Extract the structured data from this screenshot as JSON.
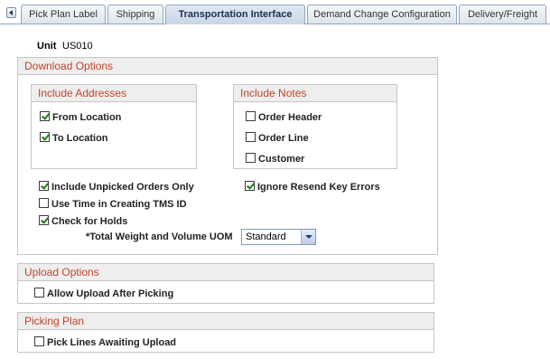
{
  "tabs": [
    {
      "label": "Pick Plan Label",
      "active": false
    },
    {
      "label": "Shipping",
      "active": false
    },
    {
      "label": "Transportation Interface",
      "active": true
    },
    {
      "label": "Demand Change Configuration",
      "active": false
    },
    {
      "label": "Delivery/Freight",
      "active": false
    }
  ],
  "unit": {
    "label": "Unit",
    "value": "US010"
  },
  "download_options": {
    "title": "Download Options",
    "include_addresses": {
      "title": "Include Addresses",
      "from_location": {
        "label": "From Location",
        "checked": true
      },
      "to_location": {
        "label": "To Location",
        "checked": true
      }
    },
    "include_notes": {
      "title": "Include Notes",
      "order_header": {
        "label": "Order Header",
        "checked": false
      },
      "order_line": {
        "label": "Order Line",
        "checked": false
      },
      "customer": {
        "label": "Customer",
        "checked": false
      }
    },
    "include_unpicked": {
      "label": "Include Unpicked Orders Only",
      "checked": true
    },
    "ignore_resend": {
      "label": "Ignore Resend Key Errors",
      "checked": true
    },
    "use_time": {
      "label": "Use Time in Creating TMS ID",
      "checked": false
    },
    "check_holds": {
      "label": "Check for Holds",
      "checked": true
    },
    "uom": {
      "label": "*Total Weight and Volume UOM",
      "selected": "Standard"
    }
  },
  "upload_options": {
    "title": "Upload Options",
    "allow_upload": {
      "label": "Allow Upload After Picking",
      "checked": false
    }
  },
  "picking_plan": {
    "title": "Picking Plan",
    "pick_lines": {
      "label": "Pick Lines Awaiting Upload",
      "checked": false
    }
  }
}
